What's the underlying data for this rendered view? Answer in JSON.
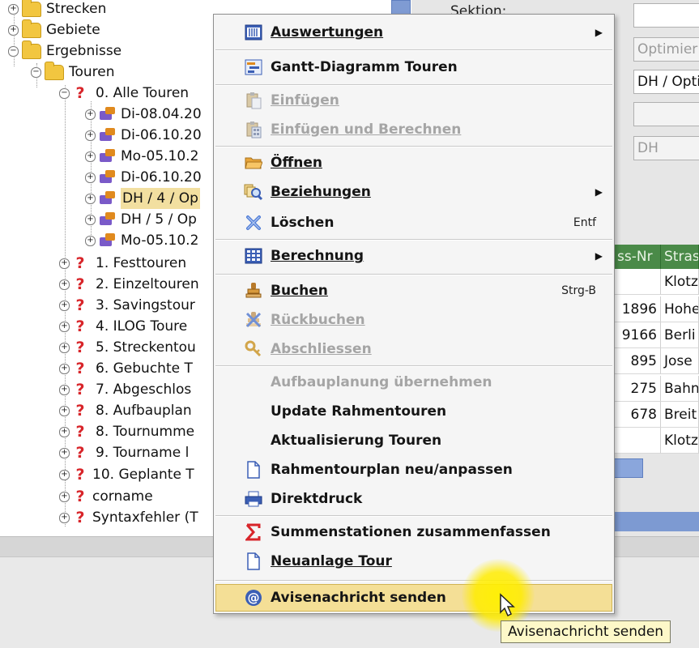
{
  "tree": {
    "items": [
      {
        "label": "Strecken",
        "type": "folder",
        "indent": 0
      },
      {
        "label": "Gebiete",
        "type": "folder",
        "indent": 0
      },
      {
        "label": "Ergebnisse",
        "type": "folder",
        "indent": 0
      },
      {
        "label": "Touren",
        "type": "folder",
        "indent": 1
      },
      {
        "label": "0. Alle Touren",
        "type": "query",
        "indent": 2
      },
      {
        "label": "Di-08.04.20",
        "type": "tour",
        "indent": 3
      },
      {
        "label": "Di-06.10.20",
        "type": "tour",
        "indent": 3
      },
      {
        "label": "Mo-05.10.2",
        "type": "tour",
        "indent": 3
      },
      {
        "label": "Di-06.10.20",
        "type": "tour",
        "indent": 3
      },
      {
        "label": "DH / 4 / Op",
        "type": "tour",
        "indent": 3,
        "selected": true
      },
      {
        "label": "DH / 5 / Op",
        "type": "tour",
        "indent": 3
      },
      {
        "label": "Mo-05.10.2",
        "type": "tour",
        "indent": 3
      },
      {
        "label": "1. Festtouren",
        "type": "query",
        "indent": 2
      },
      {
        "label": "2. Einzeltouren",
        "type": "query",
        "indent": 2
      },
      {
        "label": "3. Savingstour",
        "type": "query",
        "indent": 2
      },
      {
        "label": "4. ILOG Toure",
        "type": "query",
        "indent": 2
      },
      {
        "label": "5. Streckentou",
        "type": "query",
        "indent": 2
      },
      {
        "label": "6. Gebuchte T",
        "type": "query",
        "indent": 2
      },
      {
        "label": "7. Abgeschlos",
        "type": "query",
        "indent": 2
      },
      {
        "label": "8. Aufbauplan",
        "type": "query",
        "indent": 2
      },
      {
        "label": "8. Tournumme",
        "type": "query",
        "indent": 2
      },
      {
        "label": "9. Tourname l",
        "type": "query",
        "indent": 2
      },
      {
        "label": "10. Geplante T",
        "type": "query",
        "indent": 2
      },
      {
        "label": "corname",
        "type": "query",
        "indent": 2
      },
      {
        "label": "Syntaxfehler (T",
        "type": "query",
        "indent": 2
      }
    ]
  },
  "form": {
    "section_label": "Sektion:",
    "field_1": "",
    "field_2": "Optimier",
    "field_3": "DH / Opti",
    "field_4": "",
    "field_5": "DH"
  },
  "grid": {
    "columns": [
      "ss-Nr",
      "Stras"
    ],
    "rows": [
      [
        "",
        "Klotz"
      ],
      [
        "1896",
        "Hohe"
      ],
      [
        "9166",
        "Berli"
      ],
      [
        "895",
        "Jose"
      ],
      [
        "275",
        "Bahn"
      ],
      [
        "678",
        "Breit"
      ],
      [
        "",
        "Klotz"
      ]
    ]
  },
  "context_menu": {
    "items": [
      {
        "id": "auswertungen",
        "label": "Auswertungen",
        "icon": "report-icon",
        "submenu": true,
        "enabled": true
      },
      {
        "id": "gantt",
        "label": "Gantt-Diagramm Touren",
        "icon": "gantt-chart-icon",
        "enabled": true
      },
      {
        "id": "einfuegen",
        "label": "Einfügen",
        "icon": "paste-icon",
        "enabled": false
      },
      {
        "id": "einfuegen-berechnen",
        "label": "Einfügen und Berechnen",
        "icon": "paste-calculate-icon",
        "enabled": false
      },
      {
        "id": "oeffnen",
        "label": "Öffnen",
        "icon": "open-folder-icon",
        "enabled": true
      },
      {
        "id": "beziehungen",
        "label": "Beziehungen",
        "icon": "relations-search-icon",
        "submenu": true,
        "enabled": true
      },
      {
        "id": "loeschen",
        "label": "Löschen",
        "icon": "delete-x-icon",
        "shortcut": "Entf",
        "enabled": true
      },
      {
        "id": "berechnung",
        "label": "Berechnung",
        "icon": "calculator-icon",
        "submenu": true,
        "enabled": true
      },
      {
        "id": "buchen",
        "label": "Buchen",
        "icon": "stamp-icon",
        "shortcut": "Strg-B",
        "enabled": true
      },
      {
        "id": "rueckbuchen",
        "label": "Rückbuchen",
        "icon": "unstamp-icon",
        "enabled": false
      },
      {
        "id": "abschliessen",
        "label": "Abschliessen",
        "icon": "key-icon",
        "enabled": false
      },
      {
        "id": "aufbauplanung",
        "label": "Aufbauplanung übernehmen",
        "icon": "",
        "enabled": false
      },
      {
        "id": "update-rahmentouren",
        "label": "Update Rahmentouren",
        "icon": "",
        "enabled": true
      },
      {
        "id": "aktualisierung",
        "label": "Aktualisierung Touren",
        "icon": "",
        "enabled": true
      },
      {
        "id": "rahmentourplan",
        "label": "Rahmentourplan neu/anpassen",
        "icon": "document-icon",
        "enabled": true
      },
      {
        "id": "direktdruck",
        "label": "Direktdruck",
        "icon": "printer-icon",
        "enabled": true
      },
      {
        "id": "summenstationen",
        "label": "Summenstationen zusammenfassen",
        "icon": "sigma-icon",
        "enabled": true
      },
      {
        "id": "neuanlage",
        "label": "Neuanlage Tour",
        "icon": "new-document-icon",
        "enabled": true
      },
      {
        "id": "avisenachricht",
        "label": "Avisenachricht senden",
        "icon": "at-sign-icon",
        "enabled": true,
        "highlighted": true
      }
    ]
  },
  "tooltip": "Avisenachricht senden",
  "colors": {
    "menu_highlight": "#f4df96",
    "selected_tree": "#f2dfa0",
    "grid_header": "#4a8a48",
    "tooltip_bg": "#fdf8c8"
  }
}
